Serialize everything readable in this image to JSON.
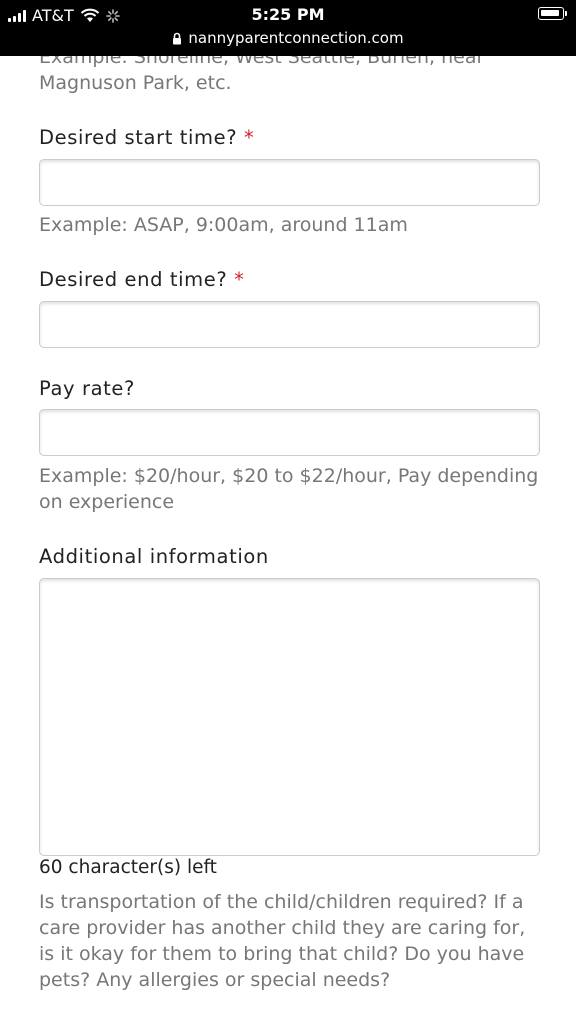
{
  "status_bar": {
    "carrier": "AT&T",
    "time": "5:25 PM",
    "url": "nannyparentconnection.com"
  },
  "form": {
    "location_help": "Example: Shoreline, West Seattle, Burien, near Magnuson Park, etc.",
    "start_time": {
      "label": "Desired start time?",
      "required_mark": "*",
      "value": "",
      "help": "Example: ASAP, 9:00am, around 11am"
    },
    "end_time": {
      "label": "Desired end time?",
      "required_mark": "*",
      "value": ""
    },
    "pay_rate": {
      "label": "Pay rate?",
      "value": "",
      "help": "Example: $20/hour, $20 to $22/hour, Pay depending on experience"
    },
    "additional_info": {
      "label": "Additional information",
      "value": "",
      "counter": "60 character(s) left",
      "help": "Is transportation of the child/children required? If a care provider has another child they are caring for, is it okay for them to bring that child? Do you have pets? Any allergies or special needs?"
    }
  }
}
